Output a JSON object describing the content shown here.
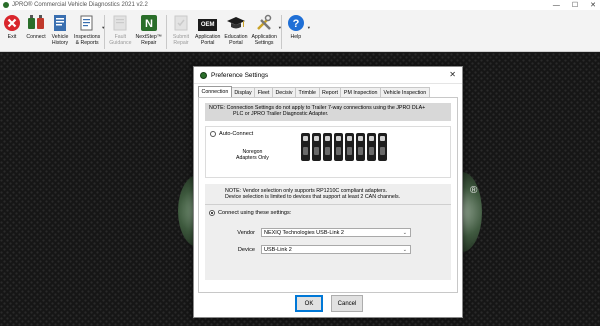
{
  "window": {
    "title": "JPRO® Commercial Vehicle Diagnostics 2021 v2.2"
  },
  "toolbar": [
    {
      "id": "exit",
      "label": "Exit",
      "icon": "exit-icon",
      "disabled": false
    },
    {
      "id": "connect",
      "label": "Connect",
      "icon": "connect-icon",
      "disabled": false
    },
    {
      "id": "vehicle-history",
      "label": "Vehicle\nHistory",
      "icon": "vehicle-history-icon",
      "disabled": false
    },
    {
      "id": "inspections-reports",
      "label": "Inspections\n& Reports",
      "icon": "inspections-icon",
      "disabled": false
    },
    {
      "id": "fault-guidance",
      "label": "Fault\nGuidance",
      "icon": "fault-guidance-icon",
      "disabled": true
    },
    {
      "id": "next-step-repair",
      "label": "NextStep™\nRepair",
      "icon": "nextstep-icon",
      "disabled": false
    },
    {
      "id": "submit-repair",
      "label": "Submit\nRepair",
      "icon": "submit-repair-icon",
      "disabled": true
    },
    {
      "id": "application-portal",
      "label": "Application\nPortal",
      "icon": "oem-icon",
      "icon_text": "OEM",
      "disabled": false
    },
    {
      "id": "education-portal",
      "label": "Education\nPortal",
      "icon": "graduation-cap-icon",
      "disabled": false
    },
    {
      "id": "application-settings",
      "label": "Application\nSettings",
      "icon": "tools-icon",
      "disabled": false
    },
    {
      "id": "help",
      "label": "Help",
      "icon": "help-icon",
      "icon_text": "?",
      "disabled": false
    }
  ],
  "dialog": {
    "title": "Preference Settings",
    "tabs": [
      {
        "label": "Connection",
        "active": true
      },
      {
        "label": "Display",
        "active": false
      },
      {
        "label": "Fleet",
        "active": false
      },
      {
        "label": "Decisiv",
        "active": false
      },
      {
        "label": "Trimble",
        "active": false
      },
      {
        "label": "Report",
        "active": false
      },
      {
        "label": "PM Inspection",
        "active": false
      },
      {
        "label": "Vehicle Inspection",
        "active": false
      }
    ],
    "note_line1": "NOTE:  Connection Settings do not apply to Trailer 7-way connections using the JPRO DLA+",
    "note_line2": "PLC or JPRO Trailer Diagnostic Adapter.",
    "auto_connect_label": "Auto-Connect",
    "noregon_line1": "Noregon",
    "noregon_line2": "Adapters Only",
    "vendor_note_line1": "NOTE: Vendor selection only supports RP1210C compliant adapters.",
    "vendor_note_line2": "Device selection is limited to devices that support at least 2 CAN channels.",
    "connect_using_label": "Connect using these settings:",
    "vendor_label": "Vendor",
    "vendor_value": "NEXIQ Technologies USB-Link 2",
    "device_label": "Device",
    "device_value": "USB-Link 2",
    "ok_label": "OK",
    "cancel_label": "Cancel",
    "selected_option": "connect-using-settings"
  },
  "background": {
    "registered_mark": "®"
  },
  "colors": {
    "accent": "#0078d7",
    "brand_green": "#2a6e2a",
    "exit_red": "#d9262c",
    "help_blue": "#1f6fd6"
  }
}
